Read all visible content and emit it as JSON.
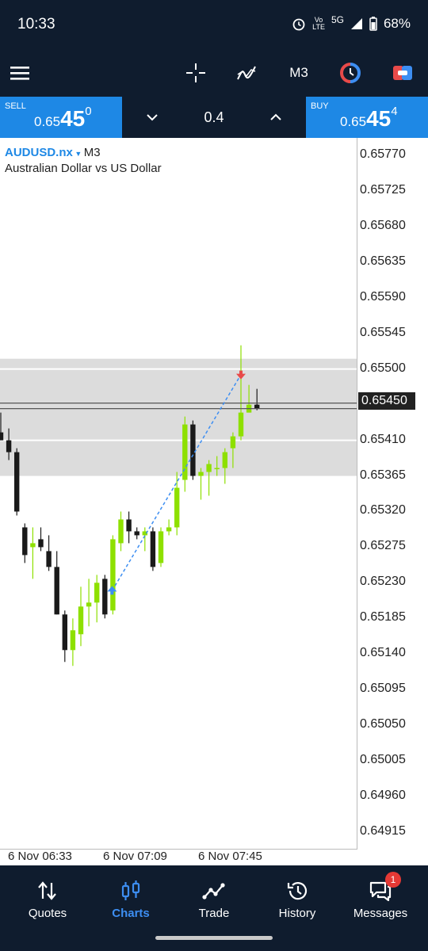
{
  "status": {
    "time": "10:33",
    "network": "5G",
    "battery": "68%"
  },
  "toolbar": {
    "timeframe": "M3",
    "accent_red": "#e84a4a",
    "accent_blue": "#3d8ef2"
  },
  "trade": {
    "sell_label": "SELL",
    "sell_price_small": "0.65",
    "sell_price_big": "45",
    "sell_price_sup": "0",
    "volume": "0.4",
    "buy_label": "BUY",
    "buy_price_small": "0.65",
    "buy_price_big": "45",
    "buy_price_sup": "4"
  },
  "chart_header": {
    "symbol": "AUDUSD.nx",
    "timeframe": "M3",
    "description": "Australian Dollar vs US Dollar"
  },
  "chart_data": {
    "type": "candlestick",
    "y_ticks": [
      "0.65770",
      "0.65725",
      "0.65680",
      "0.65635",
      "0.65590",
      "0.65545",
      "0.65500",
      "0.65410",
      "0.65365",
      "0.65320",
      "0.65275",
      "0.65230",
      "0.65185",
      "0.65140",
      "0.65095",
      "0.65050",
      "0.65005",
      "0.64960",
      "0.64915"
    ],
    "current_price": "0.65450",
    "x_ticks": [
      "6 Nov 06:33",
      "6 Nov 07:09",
      "6 Nov 07:45"
    ],
    "ylim": [
      0.64893,
      0.65792
    ],
    "bull_color": "#8ee000",
    "bear_color": "#1a1a1a",
    "zone": [
      0.65365,
      0.65513
    ],
    "zone_lines": [
      0.655,
      0.6541
    ],
    "bid_line": 0.6545,
    "ask_line": 0.65454,
    "trendline": {
      "from": 0.6522,
      "to": 0.65493
    },
    "candles": [
      {
        "o": 0.6542,
        "h": 0.65445,
        "l": 0.6541,
        "c": 0.6541
      },
      {
        "o": 0.6541,
        "h": 0.65425,
        "l": 0.65385,
        "c": 0.65395
      },
      {
        "o": 0.65395,
        "h": 0.654,
        "l": 0.65315,
        "c": 0.6532
      },
      {
        "o": 0.653,
        "h": 0.65305,
        "l": 0.65255,
        "c": 0.65265
      },
      {
        "o": 0.65275,
        "h": 0.653,
        "l": 0.65235,
        "c": 0.6528
      },
      {
        "o": 0.65285,
        "h": 0.653,
        "l": 0.6527,
        "c": 0.65275
      },
      {
        "o": 0.6527,
        "h": 0.6529,
        "l": 0.65245,
        "c": 0.6525
      },
      {
        "o": 0.6525,
        "h": 0.6527,
        "l": 0.6519,
        "c": 0.6519
      },
      {
        "o": 0.6519,
        "h": 0.65195,
        "l": 0.6513,
        "c": 0.65145
      },
      {
        "o": 0.65145,
        "h": 0.65185,
        "l": 0.65125,
        "c": 0.6517
      },
      {
        "o": 0.65165,
        "h": 0.65225,
        "l": 0.6515,
        "c": 0.652
      },
      {
        "o": 0.652,
        "h": 0.65235,
        "l": 0.65175,
        "c": 0.65205
      },
      {
        "o": 0.65205,
        "h": 0.6524,
        "l": 0.6518,
        "c": 0.6523
      },
      {
        "o": 0.65235,
        "h": 0.6524,
        "l": 0.65185,
        "c": 0.6519
      },
      {
        "o": 0.65195,
        "h": 0.6529,
        "l": 0.6519,
        "c": 0.65285
      },
      {
        "o": 0.6528,
        "h": 0.6532,
        "l": 0.6527,
        "c": 0.6531
      },
      {
        "o": 0.6531,
        "h": 0.6532,
        "l": 0.6528,
        "c": 0.65295
      },
      {
        "o": 0.65295,
        "h": 0.653,
        "l": 0.65285,
        "c": 0.6529
      },
      {
        "o": 0.6529,
        "h": 0.653,
        "l": 0.6527,
        "c": 0.65295
      },
      {
        "o": 0.65295,
        "h": 0.653,
        "l": 0.65245,
        "c": 0.6525
      },
      {
        "o": 0.65255,
        "h": 0.653,
        "l": 0.6525,
        "c": 0.65295
      },
      {
        "o": 0.65295,
        "h": 0.6531,
        "l": 0.6529,
        "c": 0.653
      },
      {
        "o": 0.653,
        "h": 0.6537,
        "l": 0.6529,
        "c": 0.6535
      },
      {
        "o": 0.6536,
        "h": 0.6544,
        "l": 0.65345,
        "c": 0.6543
      },
      {
        "o": 0.6543,
        "h": 0.65435,
        "l": 0.6536,
        "c": 0.65365
      },
      {
        "o": 0.65365,
        "h": 0.65375,
        "l": 0.65335,
        "c": 0.6537
      },
      {
        "o": 0.6537,
        "h": 0.65385,
        "l": 0.6534,
        "c": 0.6538
      },
      {
        "o": 0.65375,
        "h": 0.6539,
        "l": 0.65365,
        "c": 0.65375
      },
      {
        "o": 0.65375,
        "h": 0.654,
        "l": 0.65355,
        "c": 0.65395
      },
      {
        "o": 0.654,
        "h": 0.6542,
        "l": 0.65375,
        "c": 0.65415
      },
      {
        "o": 0.65415,
        "h": 0.6553,
        "l": 0.6541,
        "c": 0.65445
      },
      {
        "o": 0.65445,
        "h": 0.6548,
        "l": 0.65445,
        "c": 0.65455
      },
      {
        "o": 0.65455,
        "h": 0.65475,
        "l": 0.65448,
        "c": 0.6545
      }
    ]
  },
  "nav": {
    "items": [
      {
        "label": "Quotes"
      },
      {
        "label": "Charts"
      },
      {
        "label": "Trade"
      },
      {
        "label": "History"
      },
      {
        "label": "Messages"
      }
    ],
    "messages_badge": "1"
  }
}
